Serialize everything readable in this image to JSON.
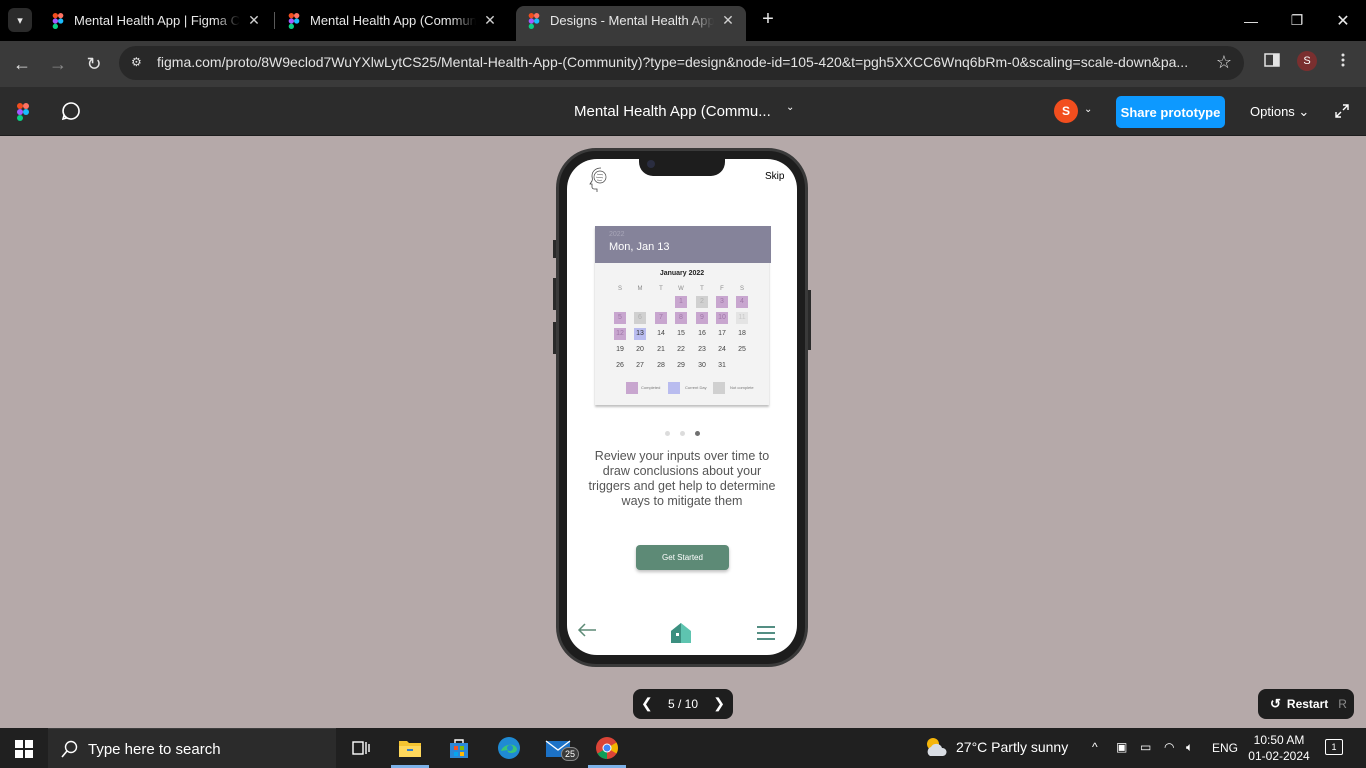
{
  "browser": {
    "tabs": [
      {
        "title": "Mental Health App | Figma Community"
      },
      {
        "title": "Mental Health App (Community)"
      },
      {
        "title": "Designs - Mental Health App (Community)"
      }
    ],
    "url": "figma.com/proto/8W9eclod7WuYXlwLytCS25/Mental-Health-App-(Community)?type=design&node-id=105-420&t=pgh5XXCC6Wnq6bRm-0&scaling=scale-down&pa...",
    "profile_initial": "S"
  },
  "figma": {
    "file_title": "Mental Health App (Commu...",
    "avatar_initial": "S",
    "share_label": "Share prototype",
    "options_label": "Options"
  },
  "screen": {
    "skip_label": "Skip",
    "calendar": {
      "year": "2022",
      "date": "Mon, Jan 13",
      "month": "January 2022",
      "weekdays": [
        "S",
        "M",
        "T",
        "W",
        "T",
        "F",
        "S"
      ],
      "days": [
        "1",
        "2",
        "3",
        "4",
        "5",
        "6",
        "7",
        "8",
        "9",
        "10",
        "11",
        "12",
        "13",
        "14",
        "15",
        "16",
        "17",
        "18",
        "19",
        "20",
        "21",
        "22",
        "23",
        "24",
        "25",
        "26",
        "27",
        "28",
        "29",
        "30",
        "31"
      ],
      "legend": [
        "Completed",
        "Current Day",
        "Not complete"
      ],
      "colors": {
        "completed": "#c8a6cf",
        "current": "#b9bcef",
        "not_complete": "#d0d0d0",
        "header": "#85839a"
      }
    },
    "pagination_dots": 3,
    "active_dot": 3,
    "description": "Review your inputs over time to draw conclusions about your triggers and get help to determine ways to mitigate them",
    "cta_label": "Get Started",
    "accent_color": "#5d8a76"
  },
  "player": {
    "page_counter": "5 / 10",
    "restart_label": "Restart",
    "restart_key": "R"
  },
  "taskbar": {
    "search_placeholder": "Type here to search",
    "mail_badge": "25",
    "weather_text": "27°C  Partly sunny",
    "language": "ENG",
    "time": "10:50 AM",
    "date": "01-02-2024",
    "notification_count": "1"
  }
}
